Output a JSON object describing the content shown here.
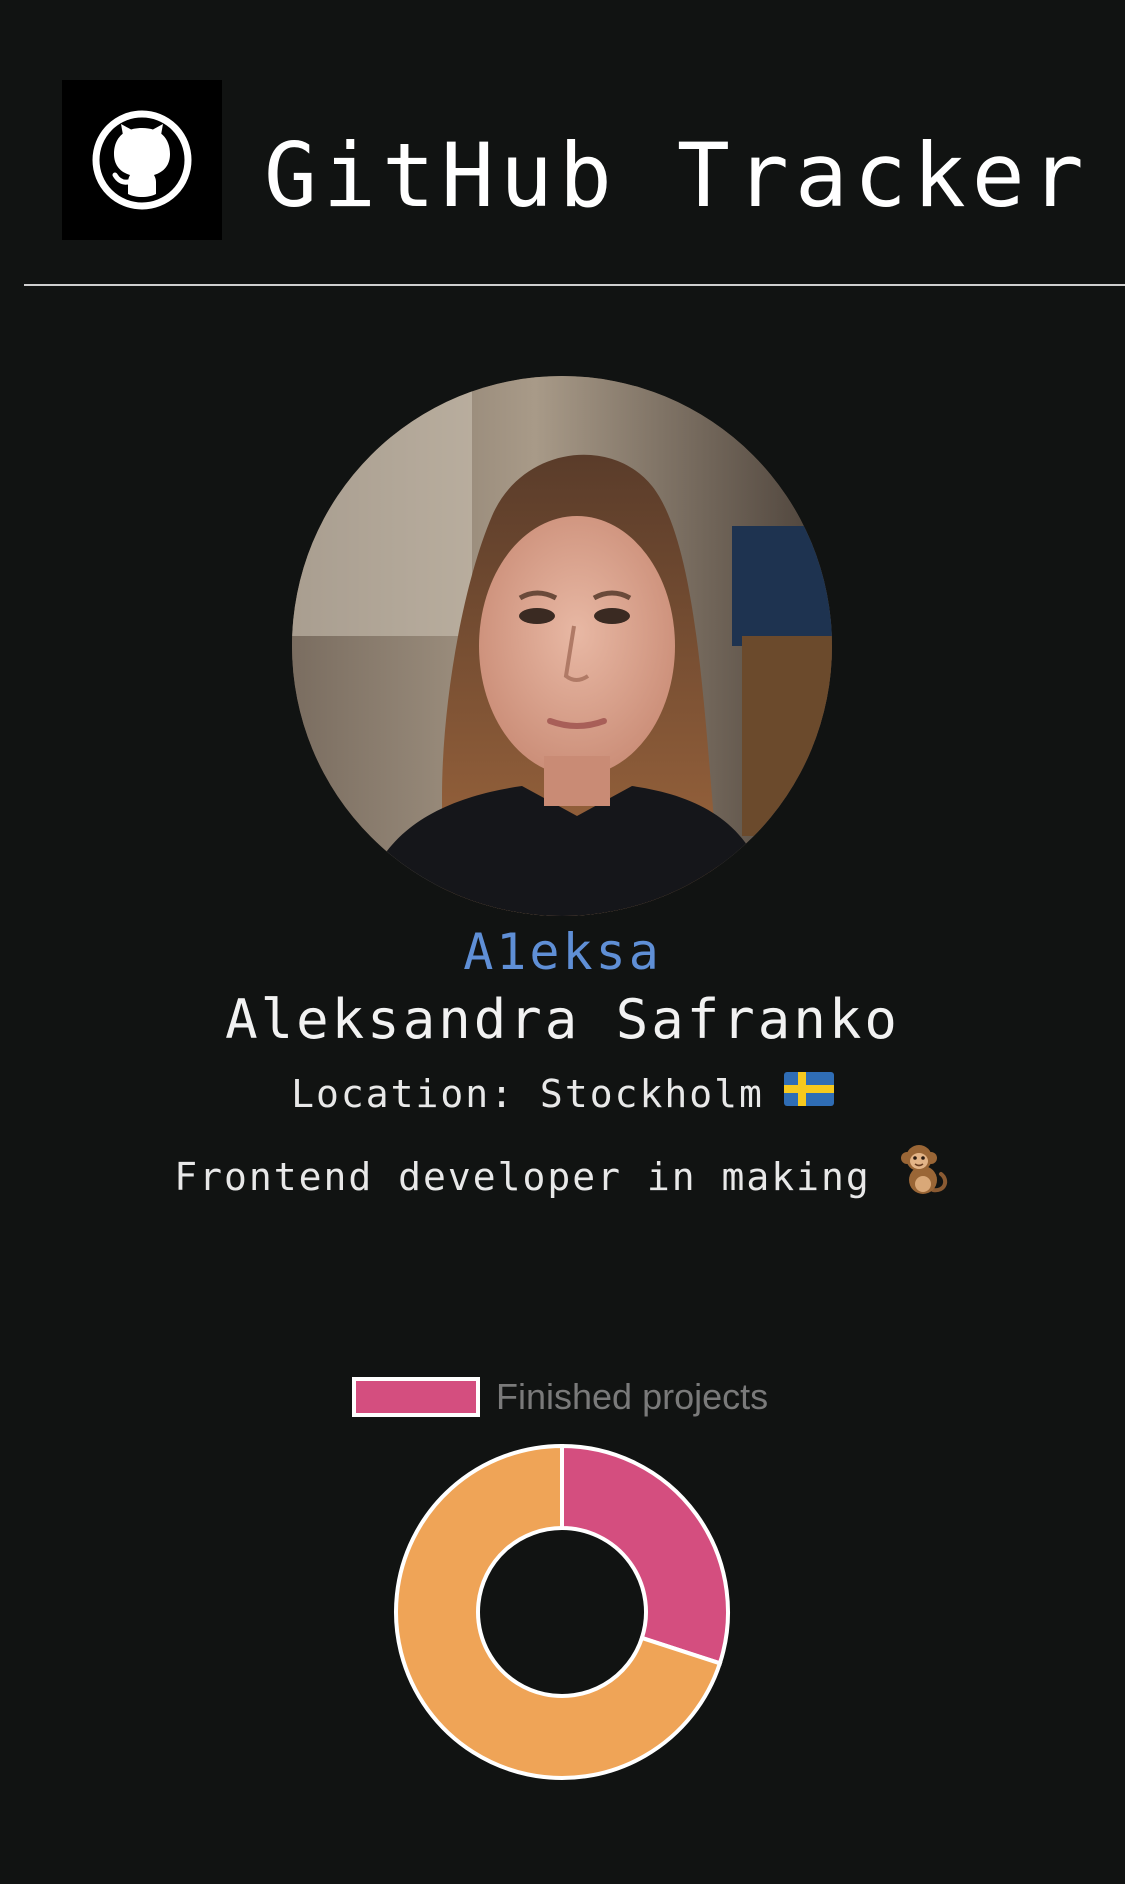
{
  "header": {
    "title": "GitHub Tracker",
    "logo_icon": "github-octocat-icon"
  },
  "profile": {
    "username": "A1eksa",
    "full_name": "Aleksandra Safranko",
    "location_label": "Location: Stockholm",
    "location_flag_icon": "sweden-flag-icon",
    "bio": "Frontend developer in making",
    "bio_emoji_icon": "monkey-icon"
  },
  "chart_data": {
    "type": "pie",
    "variant": "doughnut",
    "legend": [
      "Finished projects"
    ],
    "legend_placement": "top",
    "slices": [
      {
        "name": "Finished projects",
        "value": 30,
        "color": "#d44e7f"
      },
      {
        "value": 70,
        "color": "#efa457"
      }
    ],
    "border_color": "#ffffff"
  },
  "colors": {
    "background": "#111312",
    "username": "#5f8fd6",
    "finished_slice": "#d44e7f",
    "remaining_slice": "#efa457",
    "divider": "#cfcfcf"
  }
}
